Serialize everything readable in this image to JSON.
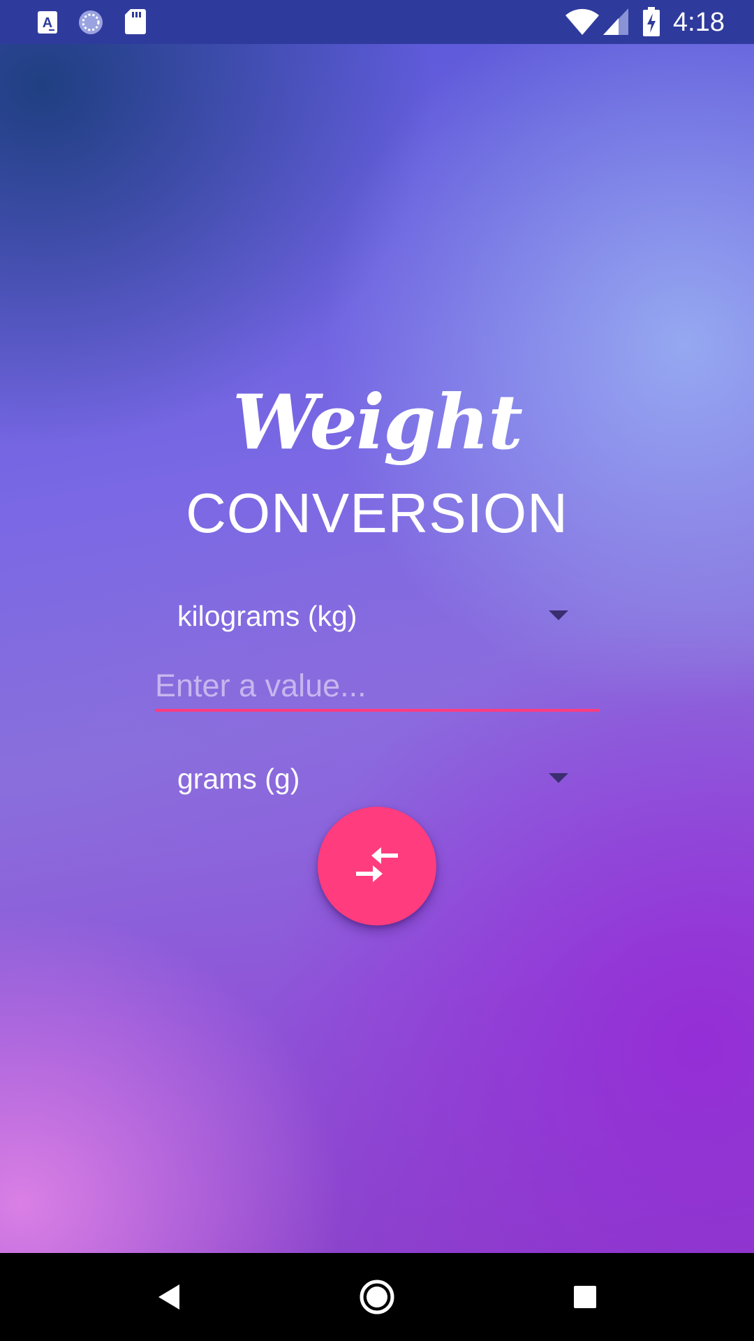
{
  "status_bar": {
    "time": "4:18",
    "icons": [
      "a-notification-icon",
      "sync-icon",
      "sd-card-icon",
      "wifi-icon",
      "signal-icon",
      "battery-charging-icon"
    ]
  },
  "app": {
    "title_script": "Weight",
    "title_sub": "CONVERSION",
    "from_unit": "kilograms (kg)",
    "value_placeholder": "Enter a value...",
    "value": "",
    "to_unit": "grams (g)",
    "convert_icon": "swap-arrows-icon"
  },
  "nav_bar": {
    "buttons": [
      "back-icon",
      "home-icon",
      "recents-icon"
    ]
  },
  "colors": {
    "status_bar": "#2f3b9c",
    "accent": "#ff3c7e",
    "nav_bar": "#000000",
    "text": "#ffffff",
    "placeholder": "#c7b6ee"
  }
}
